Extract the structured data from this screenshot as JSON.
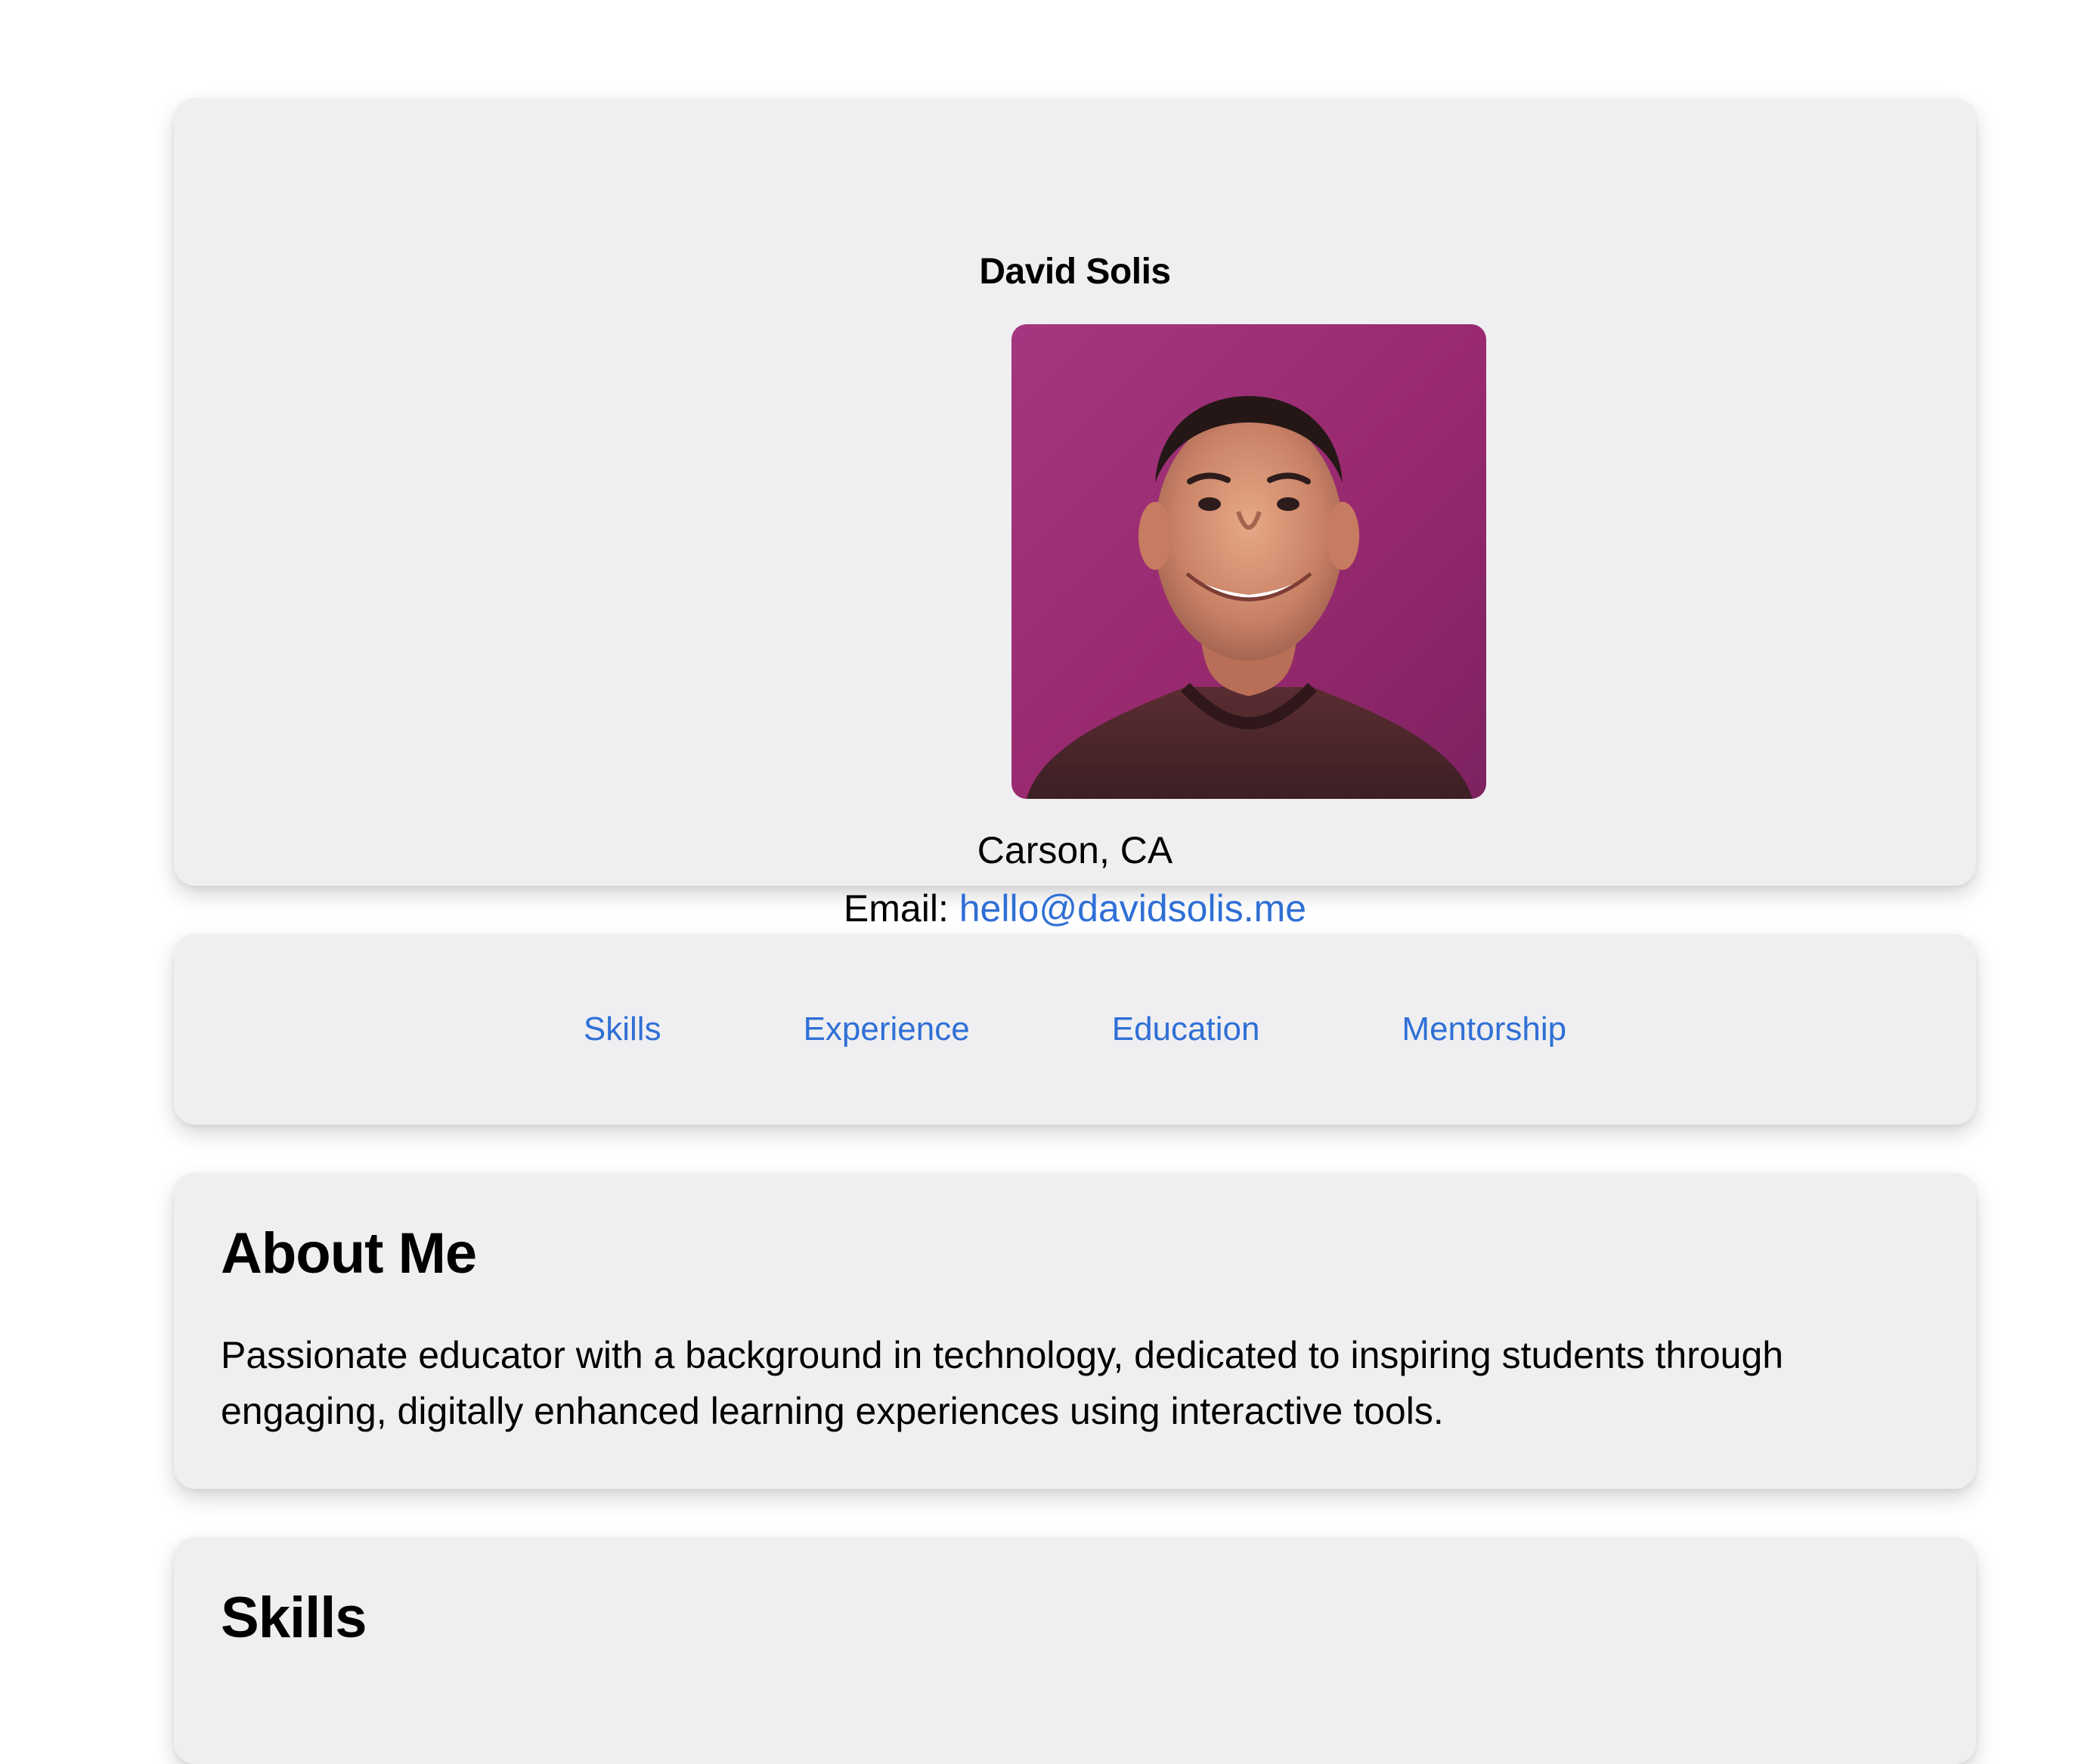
{
  "profile": {
    "name": "David Solis",
    "photo_alt": "Portrait of David Solis",
    "location": "Carson, CA",
    "email_label": "Email:",
    "email": "hello@davidsolis.me"
  },
  "nav": {
    "items": [
      {
        "label": "Skills"
      },
      {
        "label": "Experience"
      },
      {
        "label": "Education"
      },
      {
        "label": "Mentorship"
      }
    ]
  },
  "about": {
    "title": "About Me",
    "text": "Passionate educator with a background in technology, dedicated to inspiring students through engaging, digitally enhanced learning experiences using interactive tools."
  },
  "skills": {
    "title": "Skills"
  },
  "colors": {
    "card_background": "#efeff1",
    "link": "#2f6fd6",
    "photo_background": "#9b2a72"
  }
}
